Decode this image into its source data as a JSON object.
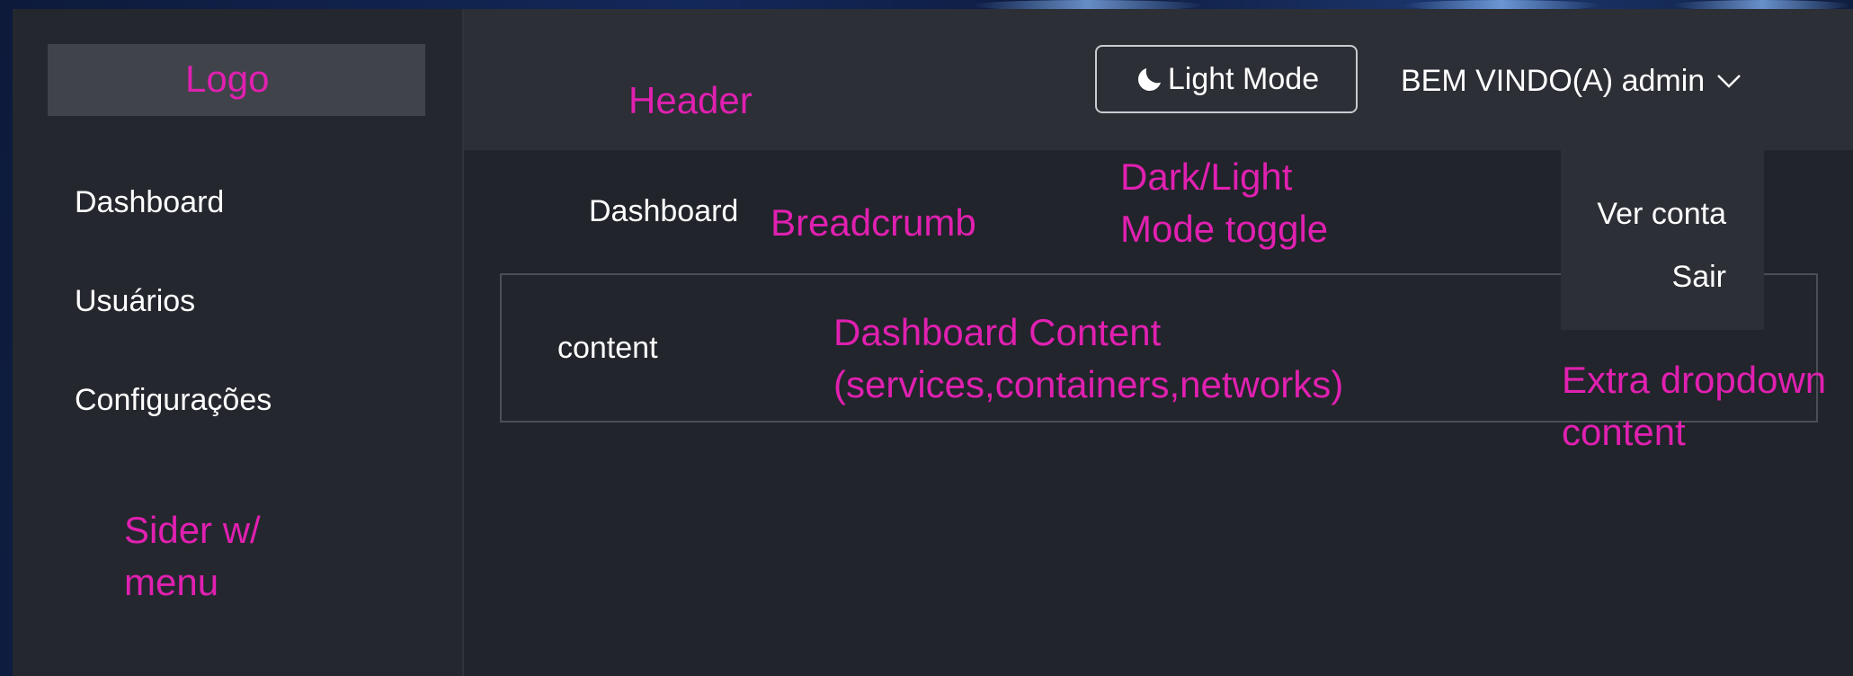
{
  "sider": {
    "logo_label": "Logo",
    "menu": [
      {
        "label": "Dashboard"
      },
      {
        "label": "Usuários"
      },
      {
        "label": "Configurações"
      }
    ]
  },
  "header": {
    "mode_toggle_label": "Light Mode",
    "mode_toggle_icon": "moon-icon",
    "user_greeting": "BEM VINDO(A) admin",
    "user_menu_icon": "chevron-down-icon"
  },
  "breadcrumb": {
    "current": "Dashboard"
  },
  "content": {
    "text": "content"
  },
  "dropdown": {
    "items": [
      {
        "label": "Ver conta"
      },
      {
        "label": "Sair"
      }
    ]
  },
  "annotations": {
    "header": "Header",
    "breadcrumb": "Breadcrumb",
    "toggle_line1": "Dark/Light",
    "toggle_line2": "Mode toggle",
    "content_line1": "Dashboard Content",
    "content_line2": "(services,containers,networks)",
    "dropdown_line1": "Extra dropdown",
    "dropdown_line2": "content",
    "sider_line1": "Sider w/",
    "sider_line2": "menu"
  },
  "colors": {
    "annotation": "#e020b0",
    "sider_bg": "#24272e",
    "header_bg": "#2c2f36",
    "content_bg": "#21242a"
  }
}
